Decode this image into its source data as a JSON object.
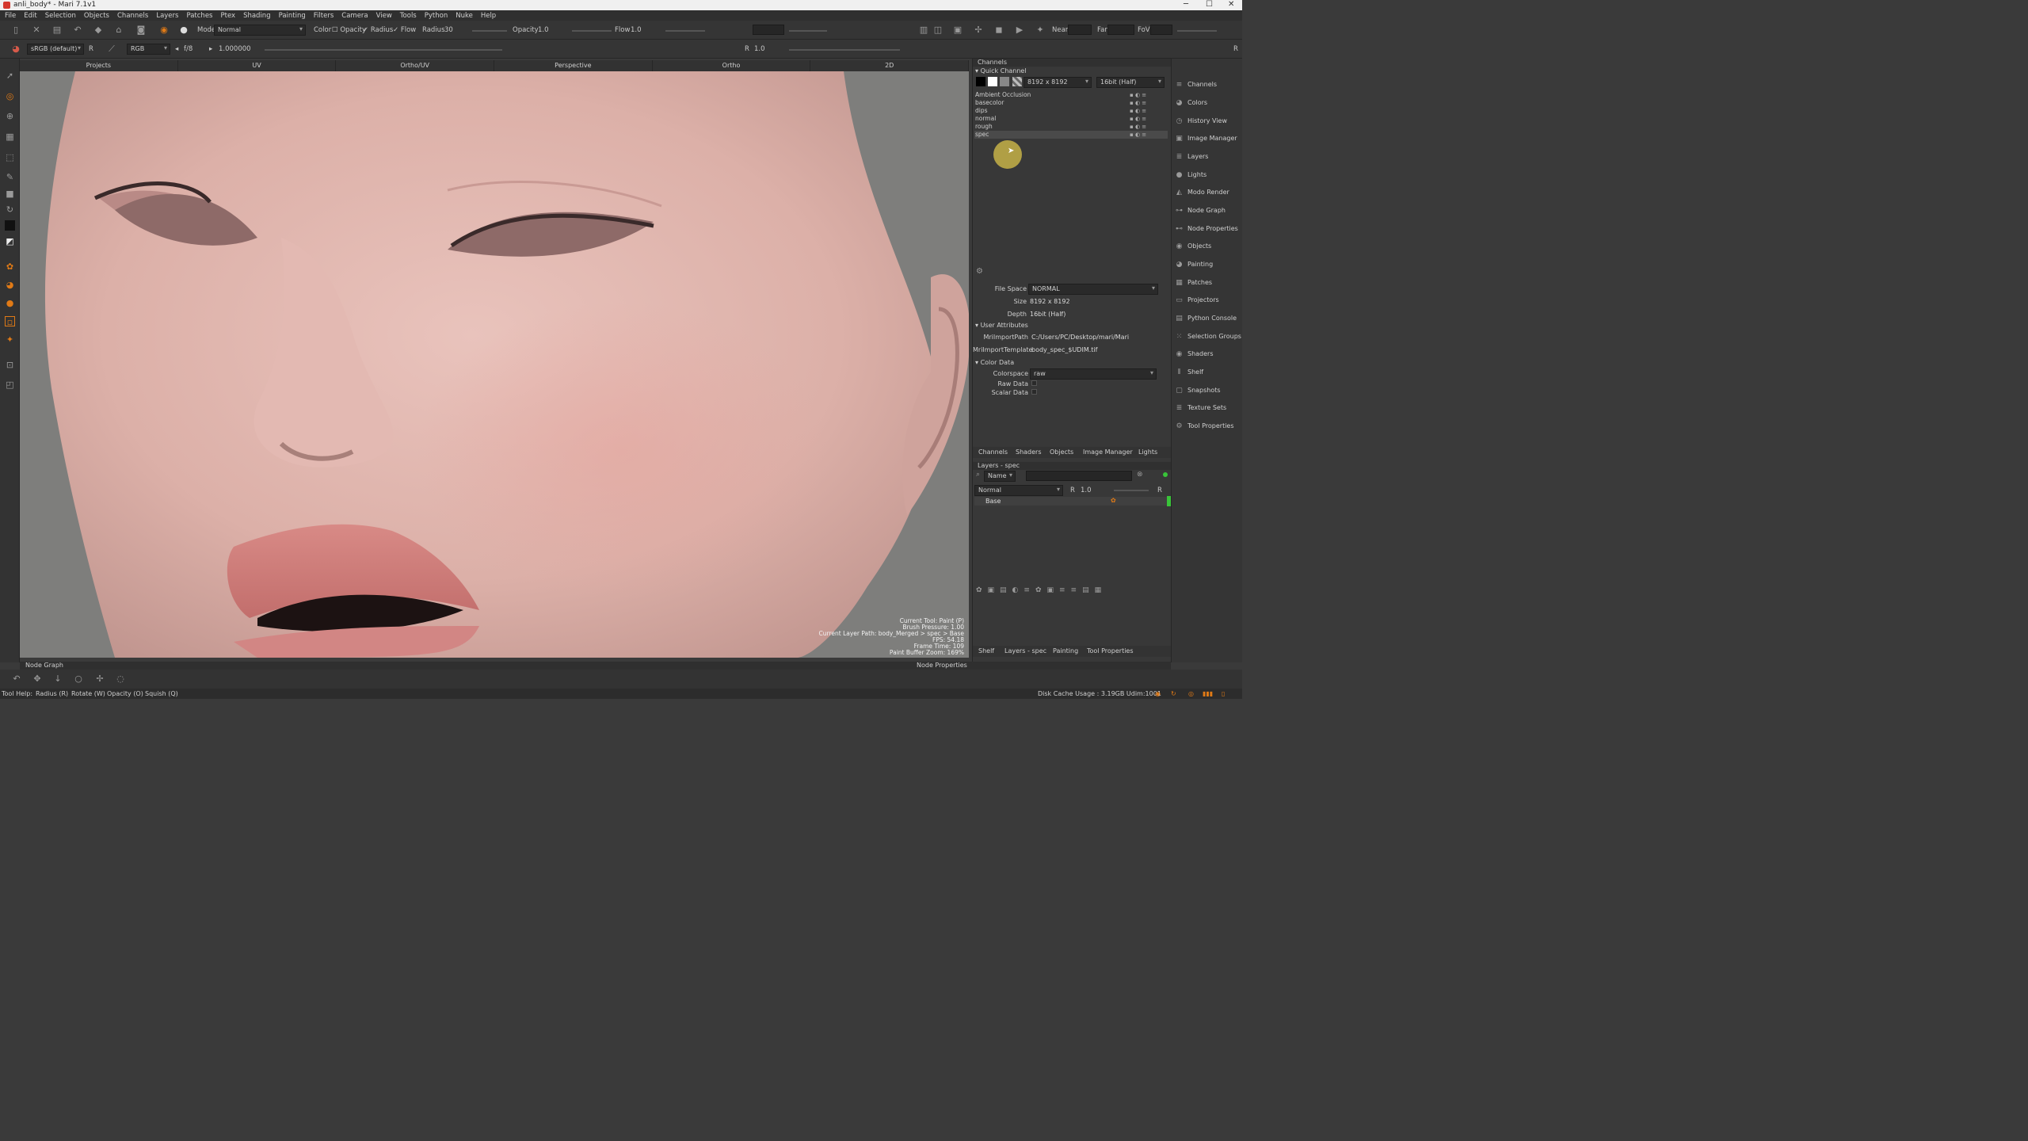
{
  "window": {
    "title": "anli_body* - Mari 7.1v1",
    "minimize": "─",
    "maximize": "☐",
    "close": "✕"
  },
  "menu": [
    "File",
    "Edit",
    "Selection",
    "Objects",
    "Channels",
    "Layers",
    "Patches",
    "Ptex",
    "Shading",
    "Painting",
    "Filters",
    "Camera",
    "View",
    "Tools",
    "Python",
    "Nuke",
    "Help"
  ],
  "toolbar1": {
    "mode_label": "Mode",
    "mode_value": "Normal",
    "color_label": "Color",
    "opacity_check": "Opacity",
    "radius_check": "Radius",
    "flow_check": "Flow",
    "radius_label": "Radius",
    "radius_value": "30",
    "opacity_label": "Opacity",
    "opacity_value": "1.0",
    "flow_label": "Flow",
    "flow_value": "1.0",
    "near_label": "Near",
    "far_label": "Far",
    "fov_label": "FoV"
  },
  "toolbar2": {
    "colorspace": "sRGB (default)",
    "r_btn": "R",
    "channels": "RGB",
    "fstop": "f/8",
    "exposure": "1.000000",
    "gain_r": "R",
    "gain_value": "1.0",
    "right_r": "R"
  },
  "view_tabs": [
    "Projects",
    "UV",
    "Ortho/UV",
    "Perspective",
    "Ortho",
    "2D"
  ],
  "hud": [
    "Current Tool: Paint (P)",
    "Brush Pressure: 1.00",
    "Current Layer Path: body_Merged > spec > Base",
    "FPS: 54.18",
    "Frame Time: 109",
    "Paint Buffer Zoom: 169%"
  ],
  "channels_panel": {
    "header": "Channels",
    "quick_channel": "Quick Channel",
    "size_value": "8192 x 8192",
    "depth_value": "16bit (Half)",
    "channels": [
      "Ambient Occlusion",
      "basecolor",
      "dips",
      "normal",
      "rough",
      "spec"
    ],
    "selected_index": 5
  },
  "properties": {
    "file_space_label": "File Space",
    "file_space_value": "NORMAL",
    "size_label": "Size",
    "size_value": "8192 x 8192",
    "depth_label": "Depth",
    "depth_value": "16bit (Half)",
    "user_attributes": "User Attributes",
    "import_path_label": "MriImportPath",
    "import_path_value": "C:/Users/PC/Desktop/mari/Mari",
    "import_template_label": "MriImportTemplate",
    "import_template_value": "body_spec_$UDIM.tif",
    "color_data": "Color Data",
    "colorspace_label": "Colorspace",
    "colorspace_value": "raw",
    "raw_data_label": "Raw Data",
    "scalar_data_label": "Scalar Data"
  },
  "mid_tabs": [
    "Channels",
    "Shaders",
    "Objects",
    "Image Manager",
    "Lights"
  ],
  "layers_panel": {
    "header": "Layers - spec",
    "filter_label": "Name",
    "blend_mode": "Normal",
    "opacity_r": "R",
    "opacity_value": "1.0",
    "right_r": "R",
    "layers": [
      "Base"
    ]
  },
  "bottom_tabs": [
    "Shelf",
    "Layers - spec",
    "Painting",
    "Tool Properties"
  ],
  "palettes": [
    "Channels",
    "Colors",
    "History View",
    "Image Manager",
    "Layers",
    "Lights",
    "Modo Render",
    "Node Graph",
    "Node Properties",
    "Objects",
    "Painting",
    "Patches",
    "Projectors",
    "Python Console",
    "Selection Groups",
    "Shaders",
    "Shelf",
    "Snapshots",
    "Texture Sets",
    "Tool Properties"
  ],
  "node_graph_label": "Node Graph",
  "node_properties_label": "Node Properties",
  "status": {
    "tool_help": "Tool Help:",
    "hints": [
      "Radius (R)",
      "Rotate (W)",
      "Opacity (O)",
      "Squish (Q)"
    ],
    "disk_cache": "Disk Cache Usage : 3.19GB Udim:1001"
  },
  "colors": {
    "accent_orange": "#e07a16",
    "green_indicator": "#39c439",
    "cursor_highlight": "#d8c24a"
  }
}
